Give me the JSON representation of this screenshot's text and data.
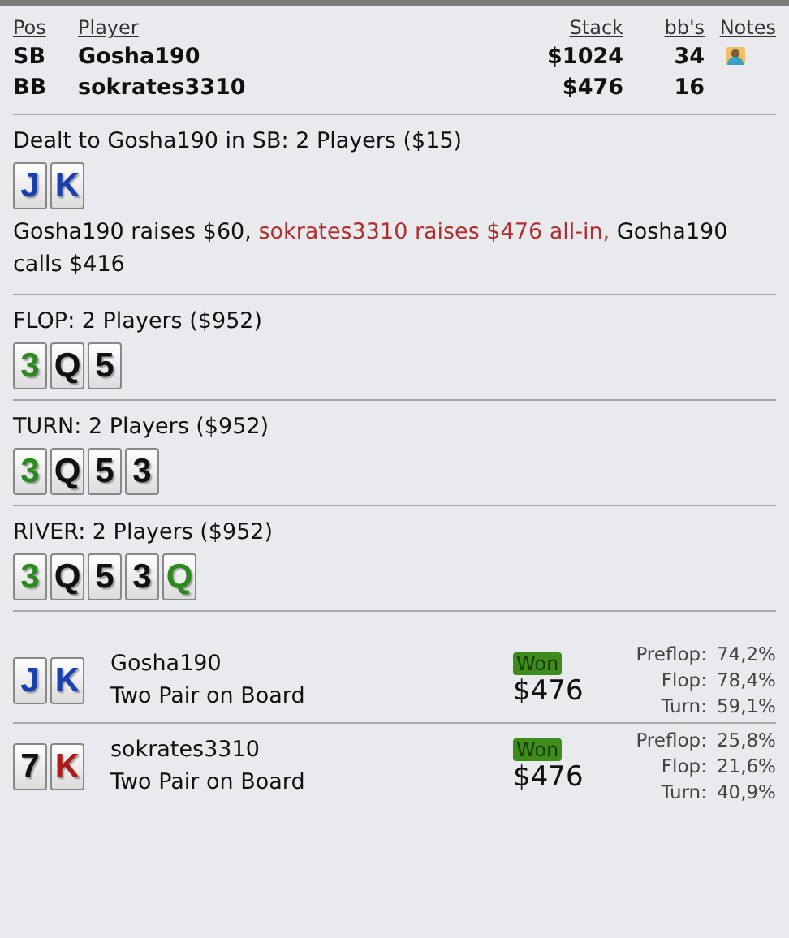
{
  "columns": [
    "Pos",
    "Player",
    "Stack",
    "bb's",
    "Notes"
  ],
  "players": [
    {
      "pos": "SB",
      "name": "Gosha190",
      "stack": "$1024",
      "bbs": "34",
      "has_note": true
    },
    {
      "pos": "BB",
      "name": "sokrates3310",
      "stack": "$476",
      "bbs": "16",
      "has_note": false
    }
  ],
  "streets": [
    {
      "title": "Dealt to Gosha190 in SB: 2 Players ($15)",
      "cards": [
        {
          "rank": "J",
          "color": "#1a3fb0"
        },
        {
          "rank": "K",
          "color": "#1a3fb0"
        }
      ],
      "actions": [
        {
          "text": "Gosha190 raises $60, ",
          "highlight": false
        },
        {
          "text": "sokrates3310 raises $476 all-in,",
          "highlight": true
        },
        {
          "text": " Gosha190 calls $416",
          "highlight": false
        }
      ]
    },
    {
      "title": "FLOP: 2 Players ($952)",
      "cards": [
        {
          "rank": "3",
          "color": "#2a8a1e"
        },
        {
          "rank": "Q",
          "color": "#111111"
        },
        {
          "rank": "5",
          "color": "#111111"
        }
      ]
    },
    {
      "title": "TURN: 2 Players ($952)",
      "cards": [
        {
          "rank": "3",
          "color": "#2a8a1e"
        },
        {
          "rank": "Q",
          "color": "#111111"
        },
        {
          "rank": "5",
          "color": "#111111"
        },
        {
          "rank": "3",
          "color": "#111111"
        }
      ]
    },
    {
      "title": "RIVER: 2 Players ($952)",
      "cards": [
        {
          "rank": "3",
          "color": "#2a8a1e"
        },
        {
          "rank": "Q",
          "color": "#111111"
        },
        {
          "rank": "5",
          "color": "#111111"
        },
        {
          "rank": "3",
          "color": "#111111"
        },
        {
          "rank": "Q",
          "color": "#2a8a1e"
        }
      ]
    }
  ],
  "results": [
    {
      "cards": [
        {
          "rank": "J",
          "color": "#1a3fb0"
        },
        {
          "rank": "K",
          "color": "#1a3fb0"
        }
      ],
      "name": "Gosha190",
      "hand": "Two Pair on Board",
      "badge": "Won",
      "amount": "$476",
      "equity": [
        {
          "label": "Preflop:",
          "value": "74,2%"
        },
        {
          "label": "Flop:",
          "value": "78,4%"
        },
        {
          "label": "Turn:",
          "value": "59,1%"
        }
      ]
    },
    {
      "cards": [
        {
          "rank": "7",
          "color": "#111111"
        },
        {
          "rank": "K",
          "color": "#b01a1a"
        }
      ],
      "name": "sokrates3310",
      "hand": "Two Pair on Board",
      "badge": "Won",
      "amount": "$476",
      "equity": [
        {
          "label": "Preflop:",
          "value": "25,8%"
        },
        {
          "label": "Flop:",
          "value": "21,6%"
        },
        {
          "label": "Turn:",
          "value": "40,9%"
        }
      ]
    }
  ]
}
